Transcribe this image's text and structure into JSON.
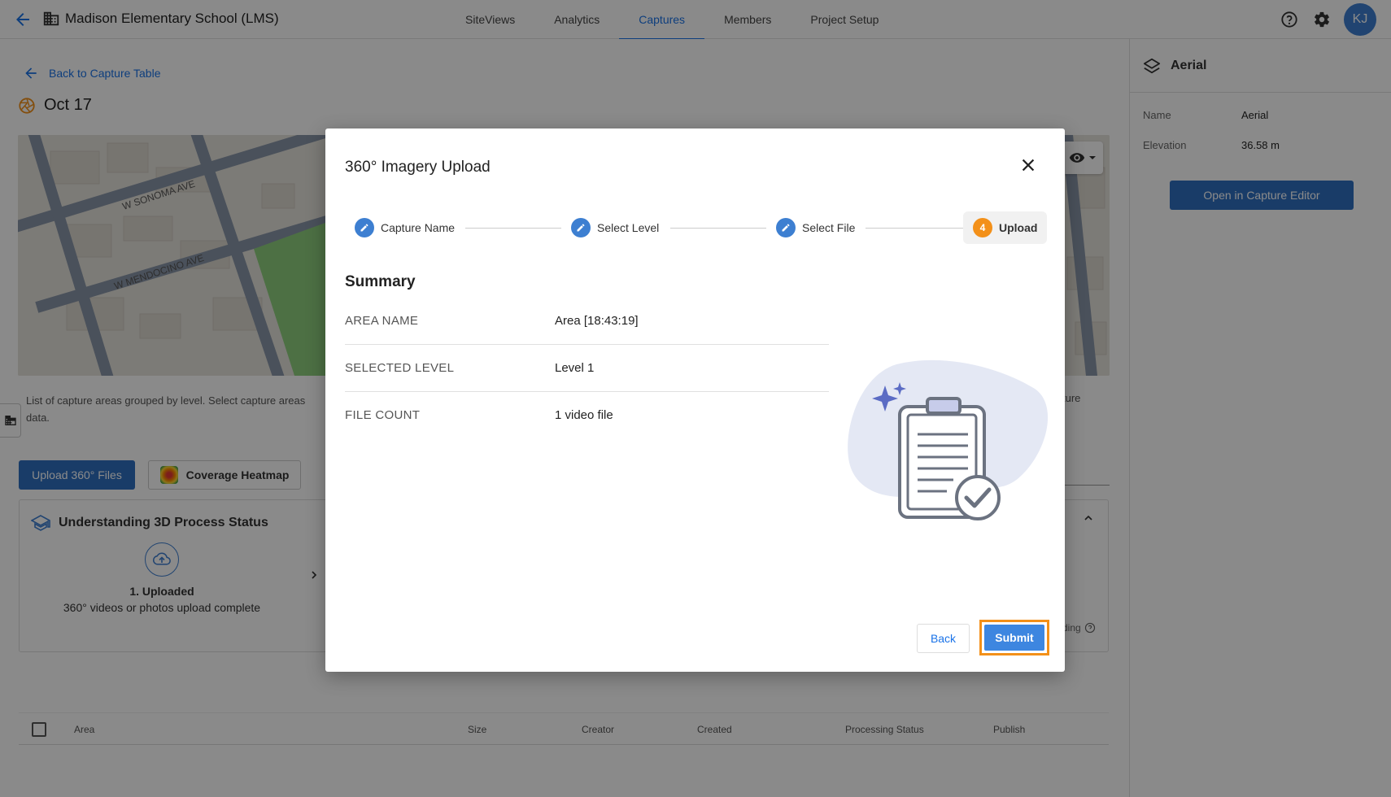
{
  "header": {
    "project_title": "Madison Elementary School (LMS)",
    "tabs": [
      {
        "label": "SiteViews",
        "active": false
      },
      {
        "label": "Analytics",
        "active": false
      },
      {
        "label": "Captures",
        "active": true
      },
      {
        "label": "Members",
        "active": false
      },
      {
        "label": "Project Setup",
        "active": false
      }
    ],
    "avatar_initials": "KJ"
  },
  "page": {
    "back_link": "Back to Capture Table",
    "capture_title": "Oct 17",
    "map_streets": [
      "W SONOMA AVE",
      "W MENDOCINO AVE"
    ],
    "description": "List of capture areas grouped by level. Select capture areas",
    "description_line2": "data.",
    "description_right": "ture",
    "upload_button": "Upload 360° Files",
    "heatmap_button": "Coverage Heatmap",
    "process_card": {
      "title": "Understanding 3D Process Status",
      "step1_title": "1. Uploaded",
      "step1_desc": "360° videos or photos upload complete",
      "right_text": "ding"
    },
    "table_columns": [
      "Area",
      "Size",
      "Creator",
      "Created",
      "Processing Status",
      "Publish"
    ]
  },
  "right_panel": {
    "title": "Aerial",
    "name_label": "Name",
    "name_value": "Aerial",
    "elevation_label": "Elevation",
    "elevation_value": "36.58 m",
    "open_editor": "Open in Capture Editor"
  },
  "modal": {
    "title": "360° Imagery Upload",
    "steps": [
      {
        "label": "Capture Name",
        "state": "done"
      },
      {
        "label": "Select Level",
        "state": "done"
      },
      {
        "label": "Select File",
        "state": "done"
      },
      {
        "label": "Upload",
        "state": "current",
        "number": "4"
      }
    ],
    "summary_title": "Summary",
    "summary": [
      {
        "label": "AREA NAME",
        "value": "Area [18:43:19]"
      },
      {
        "label": "SELECTED LEVEL",
        "value": "Level 1"
      },
      {
        "label": "FILE COUNT",
        "value": "1 video file"
      }
    ],
    "back_button": "Back",
    "submit_button": "Submit"
  },
  "colors": {
    "primary": "#2f6fc1",
    "accent": "#1a73e8",
    "step_current": "#f39019",
    "highlight_border": "#f39019"
  }
}
